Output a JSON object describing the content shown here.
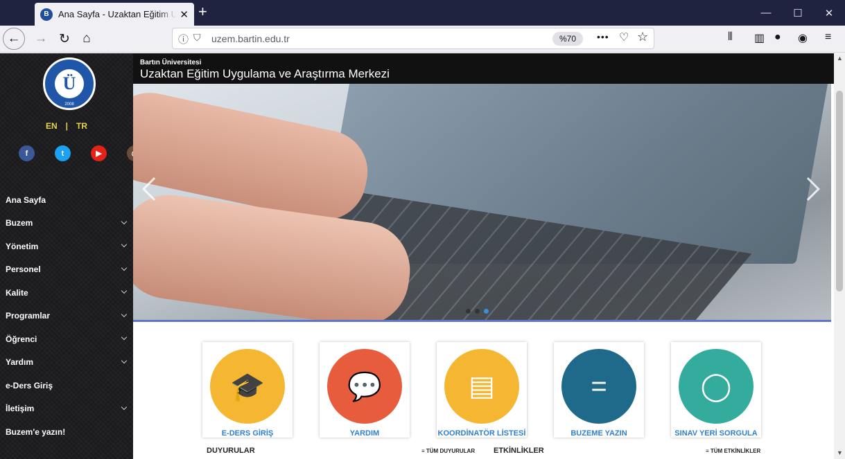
{
  "browser": {
    "tab_title": "Ana Sayfa - Uzaktan Eğitim Uyg",
    "url_domain": "uzem.bartin.edu.tr",
    "zoom": "%70"
  },
  "sidebar": {
    "lang_en": "EN",
    "lang_sep": "|",
    "lang_tr": "TR",
    "socials": [
      {
        "name": "facebook-icon",
        "glyph": "f",
        "color": "#3b5998"
      },
      {
        "name": "twitter-icon",
        "glyph": "t",
        "color": "#1da1f2"
      },
      {
        "name": "youtube-icon",
        "glyph": "▶",
        "color": "#e62117"
      },
      {
        "name": "instagram-icon",
        "glyph": "◎",
        "color": "#6b4c3b"
      }
    ],
    "menu": [
      {
        "label": "Ana Sayfa",
        "caret": false
      },
      {
        "label": "Buzem",
        "caret": true
      },
      {
        "label": "Yönetim",
        "caret": true
      },
      {
        "label": "Personel",
        "caret": true
      },
      {
        "label": "Kalite",
        "caret": true
      },
      {
        "label": "Programlar",
        "caret": true
      },
      {
        "label": "Öğrenci",
        "caret": true
      },
      {
        "label": "Yardım",
        "caret": true
      },
      {
        "label": "e-Ders Giriş",
        "caret": false
      },
      {
        "label": "İletişim",
        "caret": true
      },
      {
        "label": "Buzem'e yazın!",
        "caret": false
      }
    ]
  },
  "header": {
    "subtitle": "Bartın Üniversitesi",
    "title": "Uzaktan Eğitim Uygulama ve Araştırma Merkezi"
  },
  "cards": [
    {
      "label": "E-DERS GİRİŞ",
      "color": "#f5b731",
      "icon": "graduate-icon",
      "glyph": "🎓"
    },
    {
      "label": "YARDIM",
      "color": "#e85c3e",
      "icon": "chat-bubbles-icon",
      "glyph": "💬"
    },
    {
      "label": "KOORDİNATÖR LİSTESİ",
      "color": "#f5b731",
      "icon": "id-card-icon",
      "glyph": "▤"
    },
    {
      "label": "BUZEME YAZIN",
      "color": "#1f6a8a",
      "icon": "message-icon",
      "glyph": "="
    },
    {
      "label": "SINAV YERİ SORGULA",
      "color": "#33ab9d",
      "icon": "magnifier-icon",
      "glyph": "◯"
    }
  ],
  "sections": {
    "announcements": "DUYURULAR",
    "all_announcements": "≡ TÜM DUYURULAR",
    "events": "ETKİNLİKLER",
    "all_events": "≡ TÜM ETKİNLİKLER"
  }
}
